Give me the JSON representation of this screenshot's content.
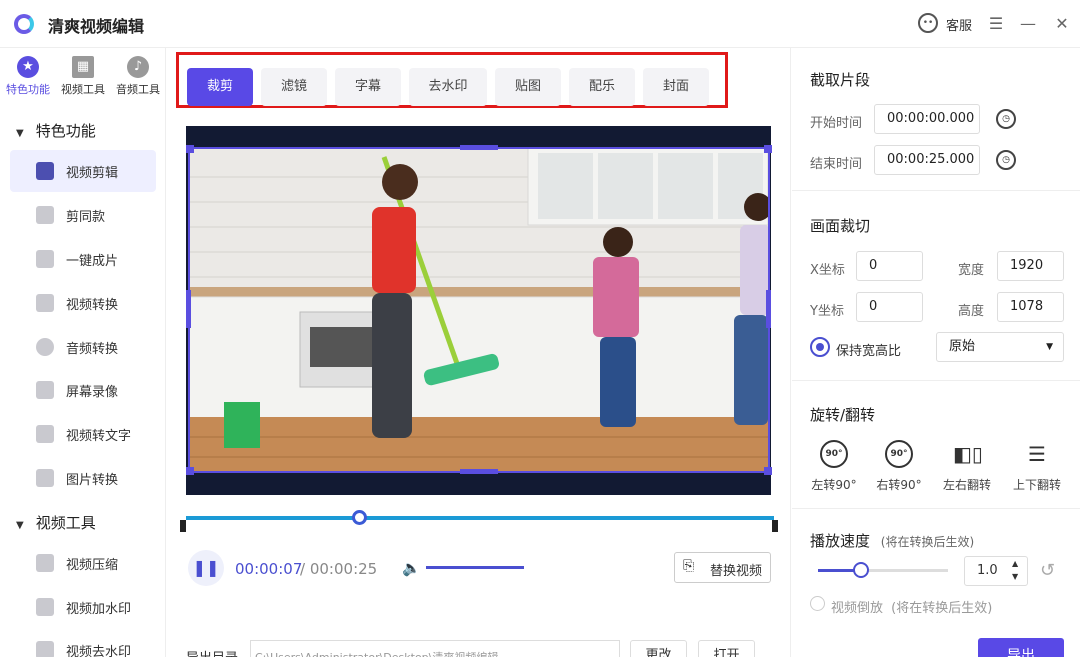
{
  "app": {
    "title": "清爽视频编辑",
    "service_label": "客服"
  },
  "sidebar": {
    "tabs": [
      {
        "label": "特色功能",
        "icon": "star-icon"
      },
      {
        "label": "视频工具",
        "icon": "film-icon"
      },
      {
        "label": "音频工具",
        "icon": "audio-icon"
      }
    ],
    "sections": [
      {
        "title": "特色功能",
        "items": [
          "视频剪辑",
          "剪同款",
          "一键成片",
          "视频转换",
          "音频转换",
          "屏幕录像",
          "视频转文字",
          "图片转换"
        ]
      },
      {
        "title": "视频工具",
        "items": [
          "视频压缩",
          "视频加水印",
          "视频去水印"
        ]
      }
    ]
  },
  "toolbar": {
    "tabs": [
      "裁剪",
      "滤镜",
      "字幕",
      "去水印",
      "贴图",
      "配乐",
      "封面"
    ],
    "active": "裁剪"
  },
  "player": {
    "current_time": "00:00:07",
    "separator": "/",
    "total_time": "00:00:25",
    "progress": 0.28,
    "volume": 1.0,
    "replace_label": "替换视频"
  },
  "output": {
    "label": "导出目录",
    "path": "C:\\Users\\Administrator\\Desktop\\清爽视频编辑",
    "change_label": "更改",
    "open_label": "打开"
  },
  "right_panel": {
    "clip": {
      "title": "截取片段",
      "start_label": "开始时间",
      "start_value": "00:00:00.000",
      "end_label": "结束时间",
      "end_value": "00:00:25.000"
    },
    "crop": {
      "title": "画面裁切",
      "x_label": "X坐标",
      "x_value": "0",
      "y_label": "Y坐标",
      "y_value": "0",
      "width_label": "宽度",
      "width_value": "1920",
      "height_label": "高度",
      "height_value": "1078",
      "keep_ratio_label": "保持宽高比",
      "ratio_value": "原始"
    },
    "rotate": {
      "title": "旋转/翻转",
      "items": [
        {
          "label": "左转90°",
          "glyph": "90°"
        },
        {
          "label": "右转90°",
          "glyph": "90°"
        },
        {
          "label": "左右翻转",
          "glyph": "◧▯"
        },
        {
          "label": "上下翻转",
          "glyph": "☰"
        }
      ]
    },
    "speed": {
      "title": "播放速度",
      "note": "(将在转换后生效)",
      "value": "1.0",
      "reverse_label": "视频倒放",
      "reverse_note": "(将在转换后生效)"
    },
    "export_label": "导出"
  },
  "colors": {
    "accent": "#5949e6",
    "highlight_box": "#e01919",
    "timeline": "#1b9ad6"
  }
}
